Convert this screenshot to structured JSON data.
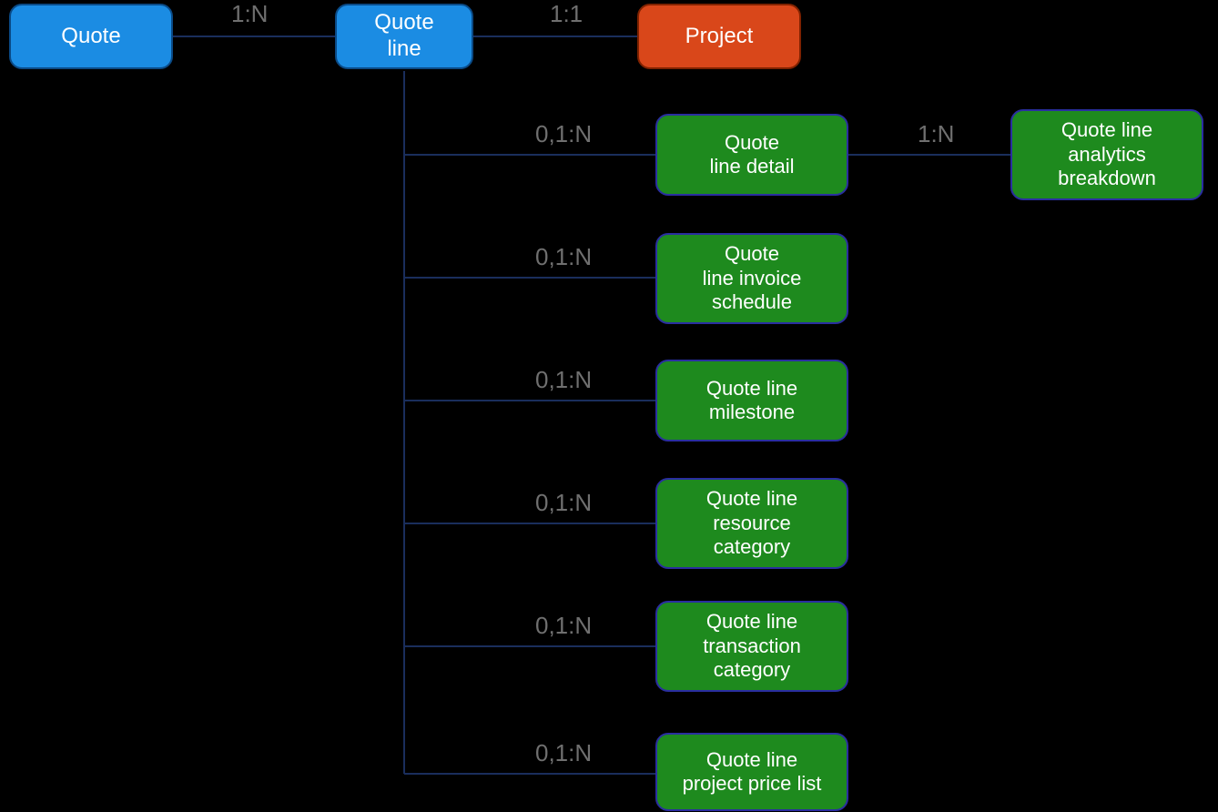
{
  "nodes": {
    "quote": {
      "label": "Quote"
    },
    "quote_line": {
      "label": "Quote\nline"
    },
    "project": {
      "label": "Project"
    },
    "quote_line_detail": {
      "label": "Quote\nline detail"
    },
    "ql_analytics": {
      "label": "Quote line\nanalytics\nbreakdown"
    },
    "ql_invoice_sched": {
      "label": "Quote\nline invoice\nschedule"
    },
    "ql_milestone": {
      "label": "Quote line\nmilestone"
    },
    "ql_resource_cat": {
      "label": "Quote line\nresource\ncategory"
    },
    "ql_txn_cat": {
      "label": "Quote line\ntransaction\ncategory"
    },
    "ql_price_list": {
      "label": "Quote line\nproject price list"
    }
  },
  "relations": {
    "quote_to_quoteline": {
      "label": "1:N"
    },
    "quoteline_to_project": {
      "label": "1:1"
    },
    "quoteline_to_detail": {
      "label": "0,1:N"
    },
    "detail_to_analytics": {
      "label": "1:N"
    },
    "quoteline_to_invoice": {
      "label": "0,1:N"
    },
    "quoteline_to_milestone": {
      "label": "0,1:N"
    },
    "quoteline_to_resource": {
      "label": "0,1:N"
    },
    "quoteline_to_txn": {
      "label": "0,1:N"
    },
    "quoteline_to_pricelist": {
      "label": "0,1:N"
    }
  },
  "colors": {
    "blue": "#1b8ce3",
    "orange": "#d9471a",
    "green": "#1e8a1e",
    "line": "#1a2e5c",
    "label": "#6f6f6f",
    "bg": "#000000"
  }
}
